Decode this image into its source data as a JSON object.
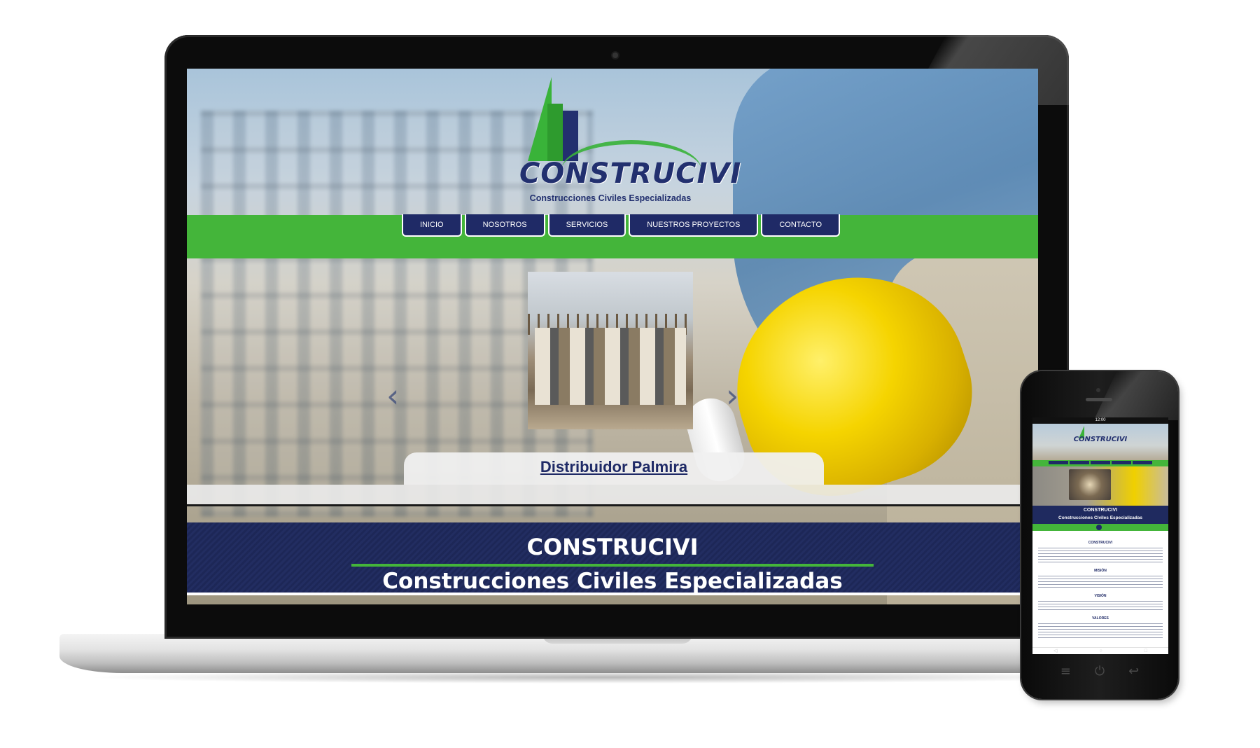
{
  "laptop_site": {
    "logo": {
      "name": "CONSTRUCIVI",
      "tagline": "Construcciones Civiles Especializadas"
    },
    "nav": [
      "INICIO",
      "NOSOTROS",
      "SERVICIOS",
      "NUESTROS PROYECTOS",
      "CONTACTO"
    ],
    "slider": {
      "caption": "Distribuidor Palmira",
      "prev_icon": "‹",
      "next_icon": "›"
    },
    "band": {
      "title": "CONSTRUCIVI",
      "subtitle": "Construcciones Civiles Especializadas"
    }
  },
  "phone_site": {
    "status_time": "12:00",
    "logo_name": "CONSTRUCIVI",
    "band_title": "CONSTRUCIVI",
    "band_subtitle": "Construcciones Civiles Especializadas",
    "headings": [
      "CONSTRUCIVI",
      "MISIÓN",
      "VISIÓN",
      "VALORES"
    ],
    "softkeys": [
      "◁",
      "○",
      "□"
    ],
    "hardware_buttons": [
      "≡",
      "⏻",
      "↩"
    ]
  },
  "colors": {
    "navy": "#1f2a66",
    "green": "#44b53a",
    "helmet_yellow": "#f5d400"
  }
}
